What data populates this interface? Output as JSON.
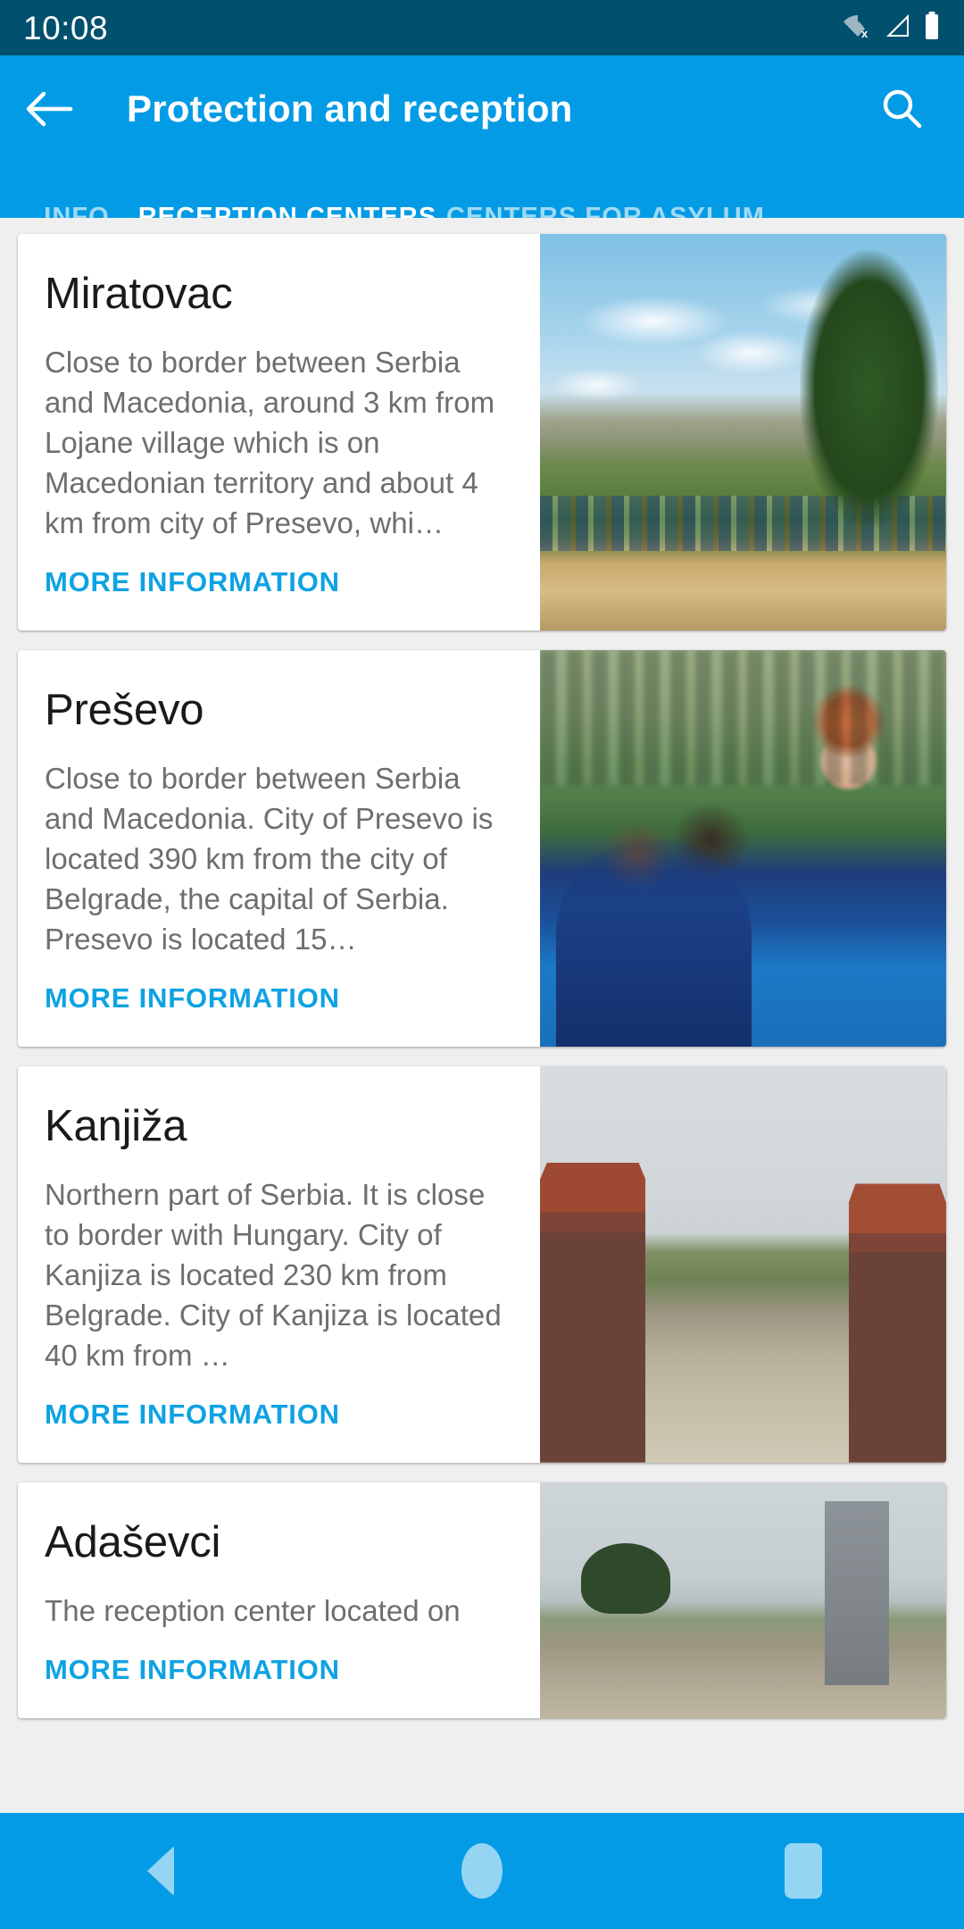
{
  "statusbar": {
    "time": "10:08",
    "icons": [
      "wifi-off-icon",
      "signal-icon",
      "battery-icon"
    ]
  },
  "appbar": {
    "back_label": "back-arrow-icon",
    "title": "Protection and reception",
    "search_label": "search-icon",
    "background_color": "#039BE5"
  },
  "tabs": {
    "active_index": 1,
    "indicator_color": "#DD3B0B",
    "items": [
      {
        "label": "INFO"
      },
      {
        "label": "RECEPTION CENTERS"
      },
      {
        "label": "CENTERS FOR ASYLUM"
      }
    ]
  },
  "list": {
    "link_label": "MORE INFORMATION",
    "link_color": "#0FA2E3",
    "cards": [
      {
        "title": "Miratovac",
        "description": "Close to border between Serbia and Macedonia, around 3 km from Lojane village which is on Macedonian territory and about 4 km from city of Presevo, whi…",
        "link": "MORE INFORMATION",
        "image": "miratovac-photo"
      },
      {
        "title": "Preševo",
        "description": "Close to border between Serbia and Macedonia. City of Presevo is located 390 km from the city of Belgrade, the capital of Serbia. Presevo is  located 15…",
        "link": "MORE INFORMATION",
        "image": "presevo-photo"
      },
      {
        "title": "Kanjiža",
        "description": "Northern part of Serbia. It is close to border with Hungary. City of Kanjiza is located 230 km from Belgrade. City of Kanjiza is located 40 km from …",
        "link": "MORE INFORMATION",
        "image": "kanjiza-photo"
      },
      {
        "title": "Adaševci",
        "description": "The reception center located on",
        "link": "MORE INFORMATION",
        "image": "adasevci-photo"
      }
    ]
  },
  "navbar": {
    "back": "nav-back-icon",
    "home": "nav-home-icon",
    "recents": "nav-recents-icon",
    "background_color": "#039BE5"
  }
}
